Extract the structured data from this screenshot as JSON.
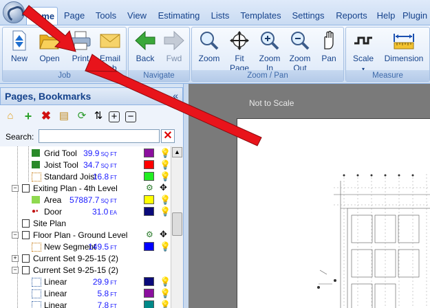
{
  "menubar": {
    "tabs": [
      {
        "label": "Home"
      },
      {
        "label": "Page"
      },
      {
        "label": "Tools"
      },
      {
        "label": "View"
      },
      {
        "label": "Estimating"
      },
      {
        "label": "Lists"
      },
      {
        "label": "Templates"
      },
      {
        "label": "Settings"
      },
      {
        "label": "Reports"
      },
      {
        "label": "Help"
      },
      {
        "label": "Plugin"
      }
    ]
  },
  "ribbon": {
    "groups": [
      {
        "label": "Job",
        "buttons": [
          {
            "label": "New",
            "icon": "new-document-icon"
          },
          {
            "label": "Open",
            "icon": "folder-open-icon"
          },
          {
            "label": "Print",
            "icon": "printer-icon"
          },
          {
            "label": "Email",
            "label2": "Job",
            "icon": "email-envelope-icon"
          }
        ]
      },
      {
        "label": "Navigate",
        "buttons": [
          {
            "label": "Back",
            "icon": "back-arrow-icon"
          },
          {
            "label": "Fwd",
            "icon": "forward-arrow-icon"
          }
        ]
      },
      {
        "label": "Zoom / Pan",
        "buttons": [
          {
            "label": "Zoom",
            "icon": "magnifier-icon"
          },
          {
            "label": "Fit",
            "label2": "Page",
            "icon": "fit-page-icon"
          },
          {
            "label": "Zoom",
            "label2": "In",
            "icon": "zoom-in-icon"
          },
          {
            "label": "Zoom",
            "label2": "Out",
            "icon": "zoom-out-icon"
          },
          {
            "label": "Pan",
            "icon": "hand-icon"
          }
        ]
      },
      {
        "label": "Measure",
        "buttons": [
          {
            "label": "Scale",
            "icon": "scale-icon"
          },
          {
            "label": "Dimension",
            "icon": "dimension-ruler-icon"
          }
        ]
      }
    ]
  },
  "panel": {
    "title": "Pages, Bookmarks",
    "collapse": "«",
    "search_label": "Search:",
    "search_value": "",
    "clear": "✕"
  },
  "tree": [
    {
      "name": "Grid Tool",
      "value": "39.9",
      "unit": "SQ FT",
      "color": "#8b0f9e"
    },
    {
      "name": "Joist Tool",
      "value": "34.7",
      "unit": "SQ FT",
      "color": "#ff0000"
    },
    {
      "name": "Standard Joist",
      "value": "16.8",
      "unit": "FT",
      "color": "#22ee22"
    },
    {
      "name": "Exiting Plan - 4th Level"
    },
    {
      "name": "Area",
      "value": "57887.7",
      "unit": "SQ FT",
      "color": "#ffff00"
    },
    {
      "name": "Door",
      "value": "31.0",
      "unit": "EA",
      "color": "#0a0a7a"
    },
    {
      "name": "Site Plan"
    },
    {
      "name": "Floor Plan - Ground Level"
    },
    {
      "name": "New Segment",
      "value": "149.5",
      "unit": "FT",
      "color": "#0000ff"
    },
    {
      "name": "Current Set 9-25-15 (2)"
    },
    {
      "name": "Current Set 9-25-15 (2)"
    },
    {
      "name": "Linear",
      "value": "29.9",
      "unit": "FT",
      "color": "#0a0a7a"
    },
    {
      "name": "Linear",
      "value": "5.8",
      "unit": "FT",
      "color": "#8b0f9e"
    },
    {
      "name": "Linear",
      "value": "7.8",
      "unit": "FT",
      "color": "#008888"
    }
  ],
  "canvas": {
    "scale_label": "Not to Scale"
  },
  "colors": {
    "annotation_arrow": "#e8141b",
    "ribbon_text": "#15428b"
  }
}
